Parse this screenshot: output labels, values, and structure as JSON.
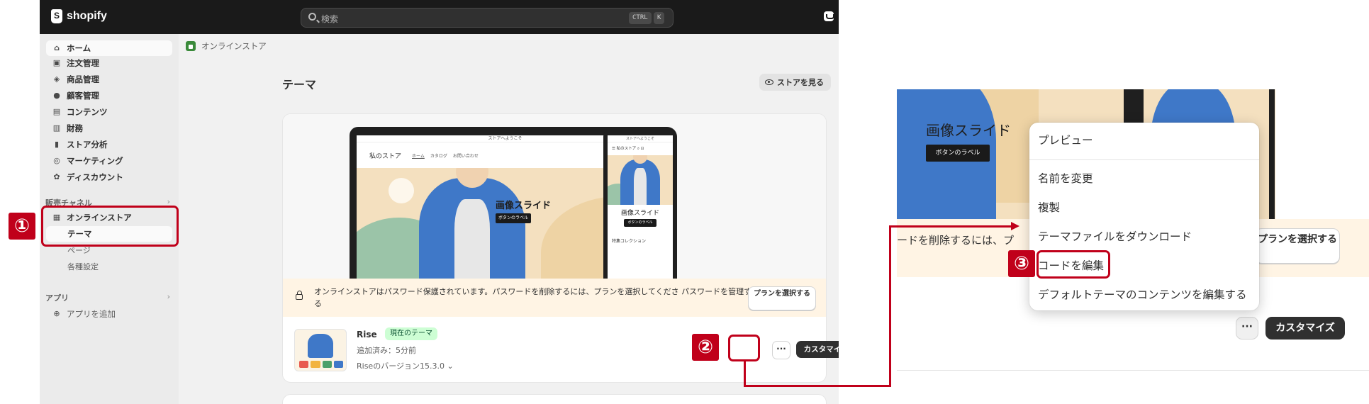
{
  "topbar": {
    "logo_text": "shopify",
    "search_placeholder": "検索",
    "shortcut_ctrl": "CTRL",
    "shortcut_key": "K"
  },
  "sidebar": {
    "items": [
      {
        "label": "ホーム",
        "icon": "home-icon",
        "glyph": "⌂"
      },
      {
        "label": "注文管理",
        "icon": "inbox-icon",
        "glyph": "▣"
      },
      {
        "label": "商品管理",
        "icon": "tag-icon",
        "glyph": "◈"
      },
      {
        "label": "顧客管理",
        "icon": "person-icon",
        "glyph": "●"
      },
      {
        "label": "コンテンツ",
        "icon": "image-icon",
        "glyph": "▤"
      },
      {
        "label": "財務",
        "icon": "bank-icon",
        "glyph": "▥"
      },
      {
        "label": "ストア分析",
        "icon": "chart-icon",
        "glyph": "▮"
      },
      {
        "label": "マーケティング",
        "icon": "target-icon",
        "glyph": "◎"
      },
      {
        "label": "ディスカウント",
        "icon": "discount-icon",
        "glyph": "✿"
      }
    ],
    "sales_channels_heading": "販売チャネル",
    "online_store": "オンラインストア",
    "online_store_glyph": "▦",
    "sub_themes": "テーマ",
    "sub_pages": "ページ",
    "sub_settings": "各種設定",
    "apps_heading": "アプリ",
    "add_app": "アプリを追加",
    "add_app_glyph": "⊕",
    "chevron": "›"
  },
  "breadcrumb": "オンラインストア",
  "page": {
    "title": "テーマ",
    "view_store": "ストアを見る"
  },
  "preview": {
    "announcement": "ストアへようこそ",
    "store_name": "私のストア",
    "nav_links": [
      "ホーム",
      "カタログ",
      "お問い合わせ"
    ],
    "nav_icons": "⌕ ⚇ ⊡",
    "phone_icons": "☰ 私のストア ⌕ ⊡",
    "slide_heading": "画像スライド",
    "slide_button": "ボタンのラベル",
    "featured": "特集コレクション"
  },
  "password_banner": {
    "text": "オンラインストアはパスワード保護されています。パスワードを削除するには、プランを選択してくださ パスワードを管理する",
    "button": "プランを選択する"
  },
  "theme": {
    "name": "Rise",
    "badge": "現在のテーマ",
    "added": "追加済み：5分前",
    "version": "Riseのバージョン15.3.0",
    "version_chevron": "⌄",
    "more_label": "···",
    "customize_label": "カスタマイズ"
  },
  "zoom": {
    "slide_heading": "画像スライド",
    "slide_button": "ボタンのラベル",
    "banner_fragment": "ードを削除するには、プ",
    "plan_button": "プランを選択する",
    "more_label": "···",
    "customize_label": "カスタマイズ"
  },
  "menu": {
    "items": [
      "プレビュー",
      "名前を変更",
      "複製",
      "テーマファイルをダウンロード",
      "コードを編集",
      "デフォルトテーマのコンテンツを編集する"
    ]
  },
  "annotations": {
    "step1": "①",
    "step2": "②",
    "step3": "③",
    "color": "#c0001a"
  },
  "colors": {
    "topbar": "#1a1a1a",
    "accent_badge_bg": "#cdfed4",
    "banner_bg": "#fff4e4",
    "primary_button": "#303030"
  }
}
